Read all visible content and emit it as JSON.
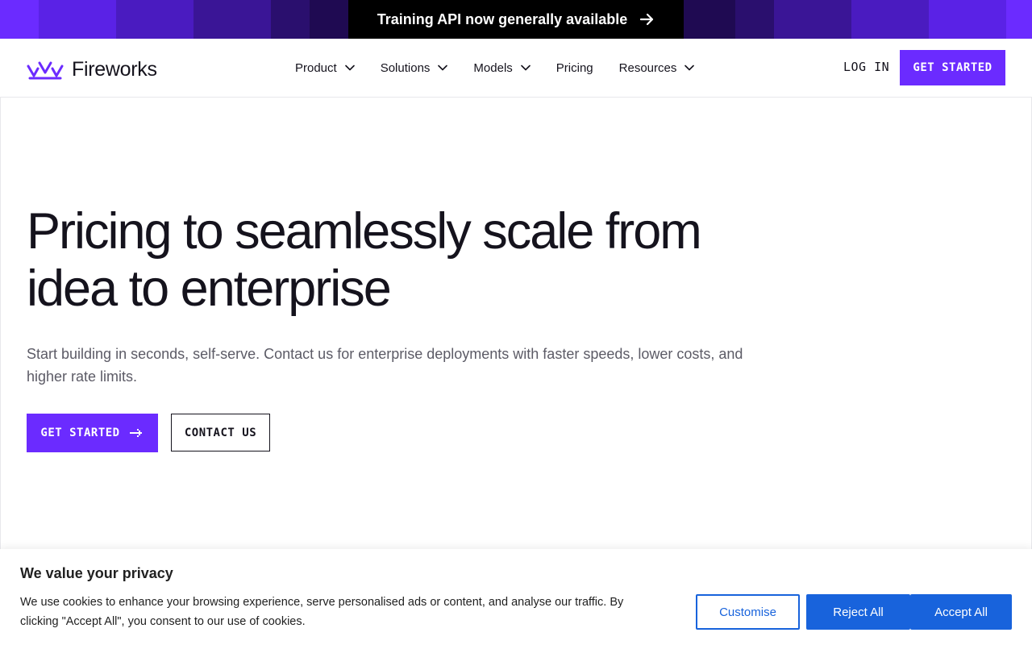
{
  "announcement": {
    "text": "Training API now generally available",
    "arrow_icon": "arrow-right-icon",
    "gradient_colors": [
      "#6b2bff",
      "#5a22e6",
      "#4a1bc0",
      "#3a1596",
      "#2a0f6e",
      "#1f0a52",
      "#140638",
      "#0b0320",
      "#0b0320",
      "#140638",
      "#1f0a52",
      "#2a0f6e",
      "#3a1596",
      "#4a1bc0",
      "#5a22e6",
      "#6b2bff"
    ]
  },
  "brand": {
    "name": "Fireworks",
    "logo_icon": "fireworks-logo-icon",
    "accent_color": "#6b2bff"
  },
  "nav": {
    "items": [
      {
        "label": "Product",
        "has_dropdown": true
      },
      {
        "label": "Solutions",
        "has_dropdown": true
      },
      {
        "label": "Models",
        "has_dropdown": true
      },
      {
        "label": "Pricing",
        "has_dropdown": false
      },
      {
        "label": "Resources",
        "has_dropdown": true
      }
    ],
    "login_label": "LOG IN",
    "cta_label": "GET STARTED"
  },
  "hero": {
    "title": "Pricing to seamlessly scale from idea to enterprise",
    "subtitle": "Start building in seconds, self-serve. Contact us for enterprise deployments with faster speeds, lower costs, and higher rate limits.",
    "primary_cta": "GET STARTED",
    "secondary_cta": "CONTACT US"
  },
  "cookie_banner": {
    "title": "We value your privacy",
    "text": "We use cookies to enhance your browsing experience, serve personalised ads or content, and analyse our traffic. By clicking \"Accept All\", you consent to our use of cookies.",
    "customise_label": "Customise",
    "reject_label": "Reject All",
    "accept_label": "Accept All",
    "button_color": "#1863dc"
  }
}
